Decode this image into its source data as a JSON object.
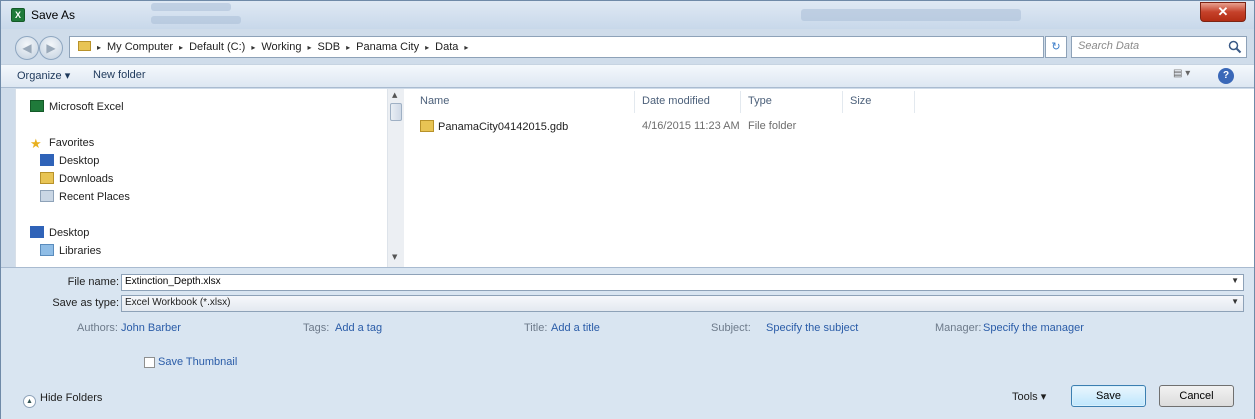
{
  "window": {
    "title": "Save As",
    "close_glyph": "✕",
    "app_icon": "excel-icon"
  },
  "address": {
    "crumbs": [
      "My Computer",
      "Default (C:)",
      "Working",
      "SDB",
      "Panama City",
      "Data"
    ],
    "separator": "▸",
    "refresh_glyph": "↻",
    "search_placeholder": "Search Data"
  },
  "toolbar": {
    "organize_label": "Organize ▾",
    "new_folder_label": "New folder",
    "views_label": "▤ ▾",
    "help_label": "?"
  },
  "nav": {
    "items": [
      {
        "label": "Microsoft Excel",
        "icon": "excel-icon"
      },
      {
        "label": "Favorites",
        "icon": "star-icon"
      },
      {
        "label": "Desktop",
        "icon": "desktop-icon"
      },
      {
        "label": "Downloads",
        "icon": "downloads-icon"
      },
      {
        "label": "Recent Places",
        "icon": "recent-places-icon"
      },
      {
        "label": "Desktop",
        "icon": "desktop-icon"
      },
      {
        "label": "Libraries",
        "icon": "libraries-icon"
      }
    ]
  },
  "files": {
    "columns": [
      "Name",
      "Date modified",
      "Type",
      "Size"
    ],
    "rows": [
      {
        "name": "PanamaCity04142015.gdb",
        "date": "4/16/2015 11:23 AM",
        "type": "File folder",
        "size": ""
      }
    ]
  },
  "save": {
    "file_name_label": "File name:",
    "file_name_value": "Extinction_Depth.xlsx",
    "save_as_type_label": "Save as type:",
    "save_as_type_value": "Excel Workbook (*.xlsx)",
    "authors_label": "Authors:",
    "authors_value": "John Barber",
    "tags_label": "Tags:",
    "tags_value": "Add a tag",
    "title_label": "Title:",
    "title_value": "Add a title",
    "subject_label": "Subject:",
    "subject_value": "Specify the subject",
    "manager_label": "Manager:",
    "manager_value": "Specify the manager",
    "thumbnail_label": "Save Thumbnail",
    "hide_folders_label": "Hide Folders",
    "tools_label": "Tools  ▾",
    "save_button": "Save",
    "cancel_button": "Cancel"
  },
  "colors": {
    "accent": "#2a5ca8",
    "excel": "#1f7a3a",
    "folder": "#e8c454",
    "close": "#c5412a"
  }
}
